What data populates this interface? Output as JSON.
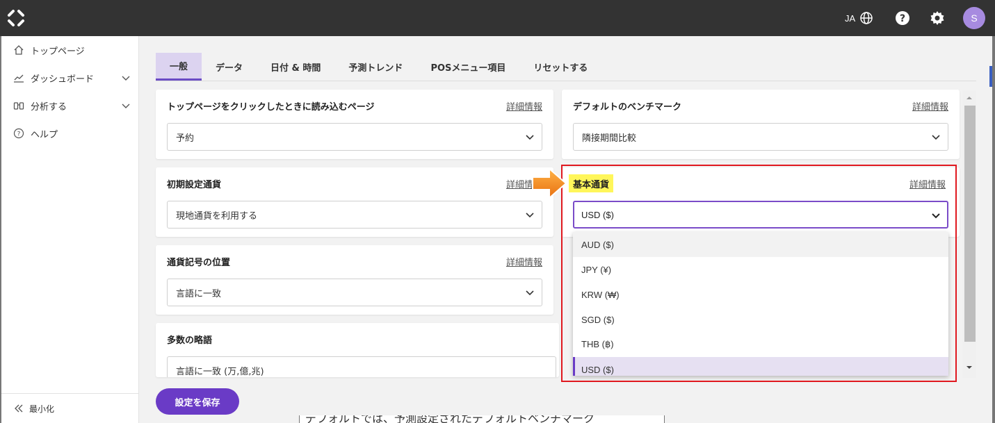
{
  "topbar": {
    "lang": "JA",
    "avatar_initial": "S"
  },
  "sidebar": {
    "items": [
      {
        "label": "トップページ",
        "icon": "home-icon"
      },
      {
        "label": "ダッシュボード",
        "icon": "chart-line-icon"
      },
      {
        "label": "分析する",
        "icon": "binoculars-icon"
      },
      {
        "label": "ヘルプ",
        "icon": "help-circle-icon"
      }
    ],
    "collapse_label": "最小化"
  },
  "tabs": [
    "一般",
    "データ",
    "日付 & 時間",
    "予測トレンド",
    "POSメニュー項目",
    "リセットする"
  ],
  "details_link": "詳細情報",
  "cards": {
    "top_page": {
      "title": "トップページをクリックしたときに読み込むページ",
      "value": "予約"
    },
    "benchmark": {
      "title": "デフォルトのベンチマーク",
      "value": "隣接期間比較"
    },
    "initial_currency": {
      "title": "初期設定通貨",
      "value": "現地通貨を利用する"
    },
    "symbol_position": {
      "title": "通貨記号の位置",
      "value": "言語に一致"
    },
    "abbreviation": {
      "title": "多数の略語",
      "value": "言語に一致 (万,億,兆)"
    }
  },
  "base_currency": {
    "title": "基本通貨",
    "value": "USD ($)",
    "options": [
      "AUD ($)",
      "JPY (¥)",
      "KRW (₩)",
      "SGD ($)",
      "THB (฿)",
      "USD ($)"
    ]
  },
  "save_label": "設定を保存",
  "bottom_fragment": "デフォルトでは、予測設定されたデフォルトベンチマーク",
  "colors": {
    "accent": "#6a3bc6",
    "highlight_border": "#e0181f",
    "highlight_label": "#fff65a",
    "arrow": "#f08a1c"
  }
}
